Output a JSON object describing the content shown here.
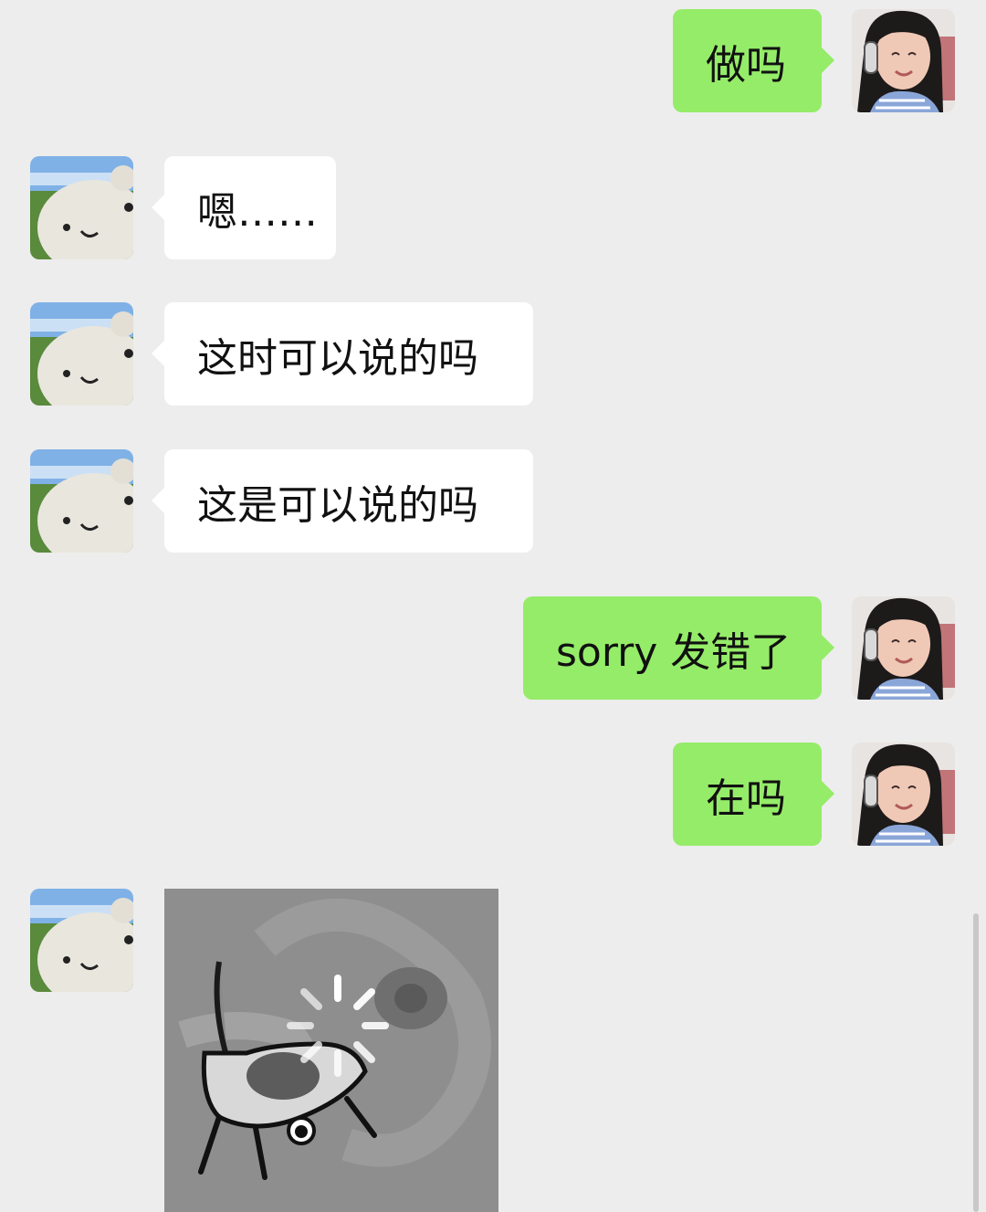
{
  "conversation": {
    "messages": [
      {
        "side": "out",
        "type": "text",
        "text": "做吗"
      },
      {
        "side": "in",
        "type": "text",
        "text": "嗯……"
      },
      {
        "side": "in",
        "type": "text",
        "text": "这时可以说的吗"
      },
      {
        "side": "in",
        "type": "text",
        "text": "这是可以说的吗"
      },
      {
        "side": "out",
        "type": "text",
        "text": "sorry 发错了"
      },
      {
        "side": "out",
        "type": "text",
        "text": "在吗"
      },
      {
        "side": "in",
        "type": "image",
        "status": "loading"
      }
    ]
  },
  "avatars": {
    "self_icon": "girl-with-headphones-avatar",
    "contact_icon": "white-cat-avatar"
  },
  "colors": {
    "background": "#ededed",
    "incoming_bubble": "#ffffff",
    "outgoing_bubble": "#95ec69"
  }
}
